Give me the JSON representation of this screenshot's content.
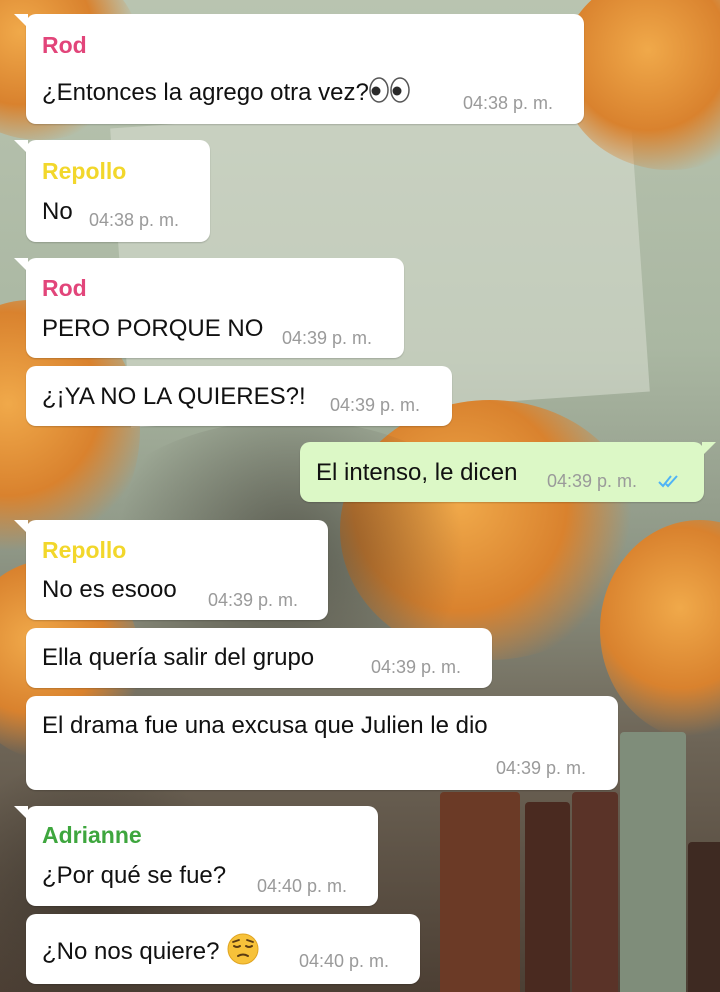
{
  "colors": {
    "sender_rod": "#e2457a",
    "sender_repollo": "#f2d72b",
    "sender_adrianne": "#3ea63e",
    "outgoing_bubble": "#dcf8c6",
    "read_ticks": "#4fb3f6"
  },
  "messages": [
    {
      "sender": "Rod",
      "text": "¿Entonces la agrego otra vez?",
      "emoji": "eyes-emoji",
      "time": "04:38 p. m."
    },
    {
      "sender": "Repollo",
      "text": "No",
      "time": "04:38 p. m."
    },
    {
      "sender": "Rod",
      "text": "PERO PORQUE NO",
      "time": "04:39 p. m."
    },
    {
      "text": "¿¡YA NO LA QUIERES?!",
      "time": "04:39 p. m."
    },
    {
      "text": "El intenso, le dicen",
      "time": "04:39 p. m.",
      "status": "read-double-check-icon"
    },
    {
      "sender": "Repollo",
      "text": "No es esooo",
      "time": "04:39 p. m."
    },
    {
      "text": "Ella quería salir del grupo",
      "time": "04:39 p. m."
    },
    {
      "text": "El drama fue una excusa que Julien le dio",
      "time": "04:39 p. m."
    },
    {
      "sender": "Adrianne",
      "text": "¿Por qué se fue?",
      "time": "04:40 p. m."
    },
    {
      "text": "¿No nos quiere?",
      "emoji": "pensive-face-emoji",
      "time": "04:40 p. m."
    }
  ]
}
